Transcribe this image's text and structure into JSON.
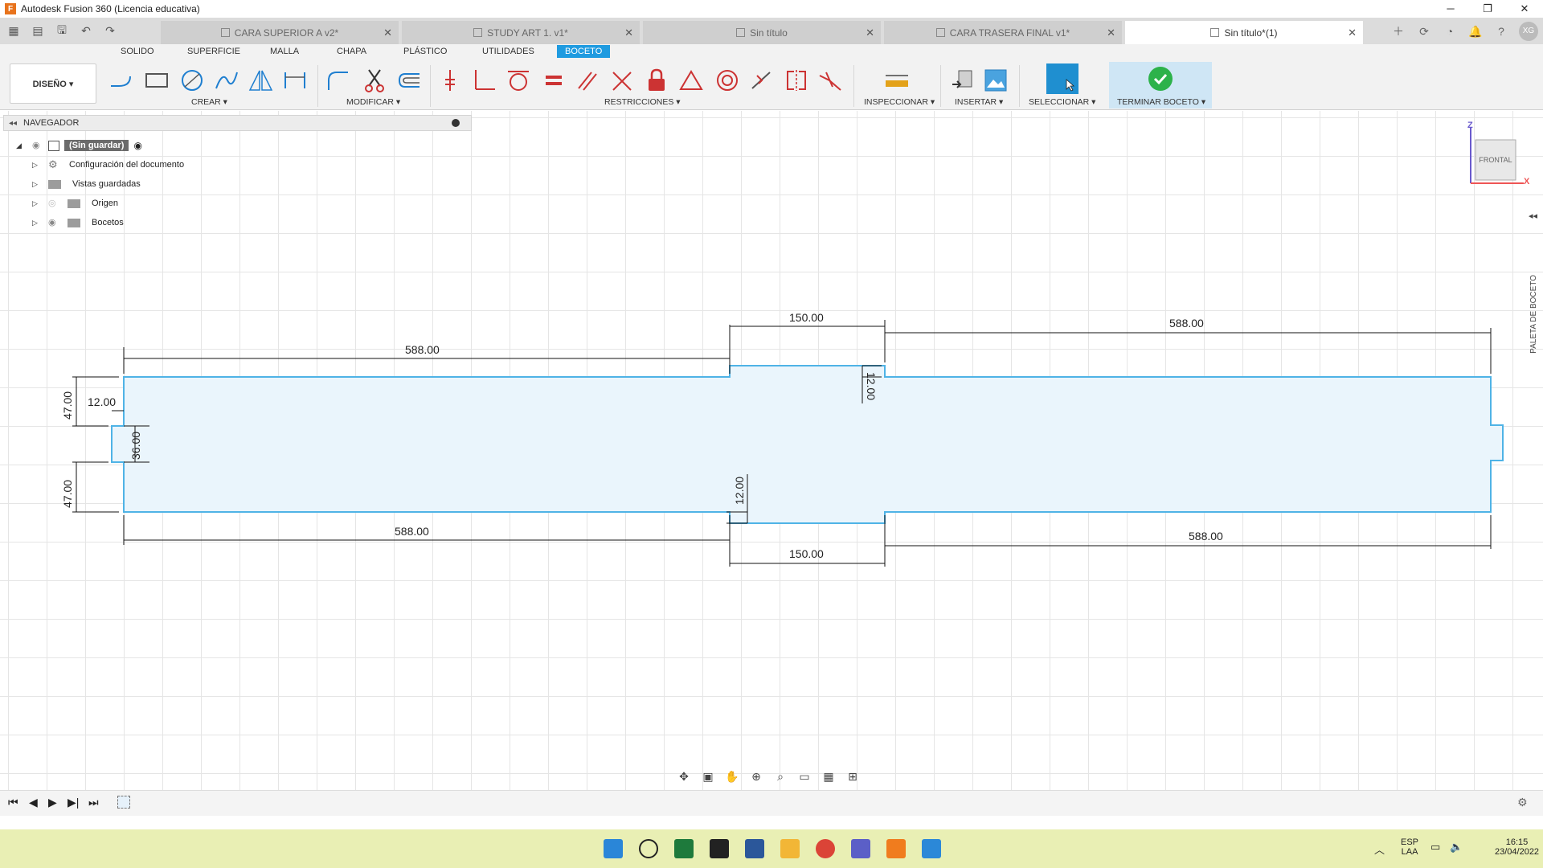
{
  "window": {
    "title": "Autodesk Fusion 360 (Licencia educativa)"
  },
  "doc_tabs": [
    {
      "label": "CARA SUPERIOR A v2*",
      "active": false
    },
    {
      "label": "STUDY ART 1. v1*",
      "active": false
    },
    {
      "label": "Sin título",
      "active": false
    },
    {
      "label": "CARA TRASERA FINAL v1*",
      "active": false
    },
    {
      "label": "Sin título*(1)",
      "active": true
    }
  ],
  "user_initials": "XG",
  "ribbon_tabs": [
    "SOLIDO",
    "SUPERFICIE",
    "MALLA",
    "CHAPA",
    "PLÁSTICO",
    "UTILIDADES",
    "BOCETO"
  ],
  "active_ribbon_tab": "BOCETO",
  "workspace": "DISEÑO ▾",
  "groups": {
    "crear": "CREAR ▾",
    "modificar": "MODIFICAR ▾",
    "restricciones": "RESTRICCIONES ▾",
    "inspeccionar": "INSPECCIONAR ▾",
    "insertar": "INSERTAR ▾",
    "seleccionar": "SELECCIONAR ▾",
    "terminar": "TERMINAR BOCETO ▾"
  },
  "navigator": {
    "title": "NAVEGADOR",
    "root": "(Sin guardar)",
    "items": [
      {
        "label": "Configuración del documento",
        "icon": "gear-icon"
      },
      {
        "label": "Vistas guardadas",
        "icon": "folder-icon"
      },
      {
        "label": "Origen",
        "icon": "folder-icon"
      },
      {
        "label": "Bocetos",
        "icon": "folder-icon"
      }
    ]
  },
  "viewcube": {
    "face": "FRONTAL",
    "axis_z": "Z",
    "axis_x": "X"
  },
  "sketch_palette": "PALETA DE BOCETO",
  "dimensions": {
    "top_left": "588.00",
    "top_mid": "150.00",
    "top_right": "588.00",
    "bottom_left": "588.00",
    "bottom_mid": "150.00",
    "bottom_right": "588.00",
    "left_upper": "47.00",
    "left_lower": "47.00",
    "notch_depth": "12.00",
    "notch_height": "36.00",
    "step_top": "12.00",
    "step_bottom": "12.00"
  },
  "colors": {
    "accent": "#1f9be0",
    "sketch_line": "#4fb3e6",
    "sketch_fill": "#eaf5fc",
    "taskbar": "#e9efb4"
  },
  "taskbar": {
    "lang": "ESP",
    "layout": "LAA",
    "time": "16:15",
    "date": "23/04/2022"
  }
}
